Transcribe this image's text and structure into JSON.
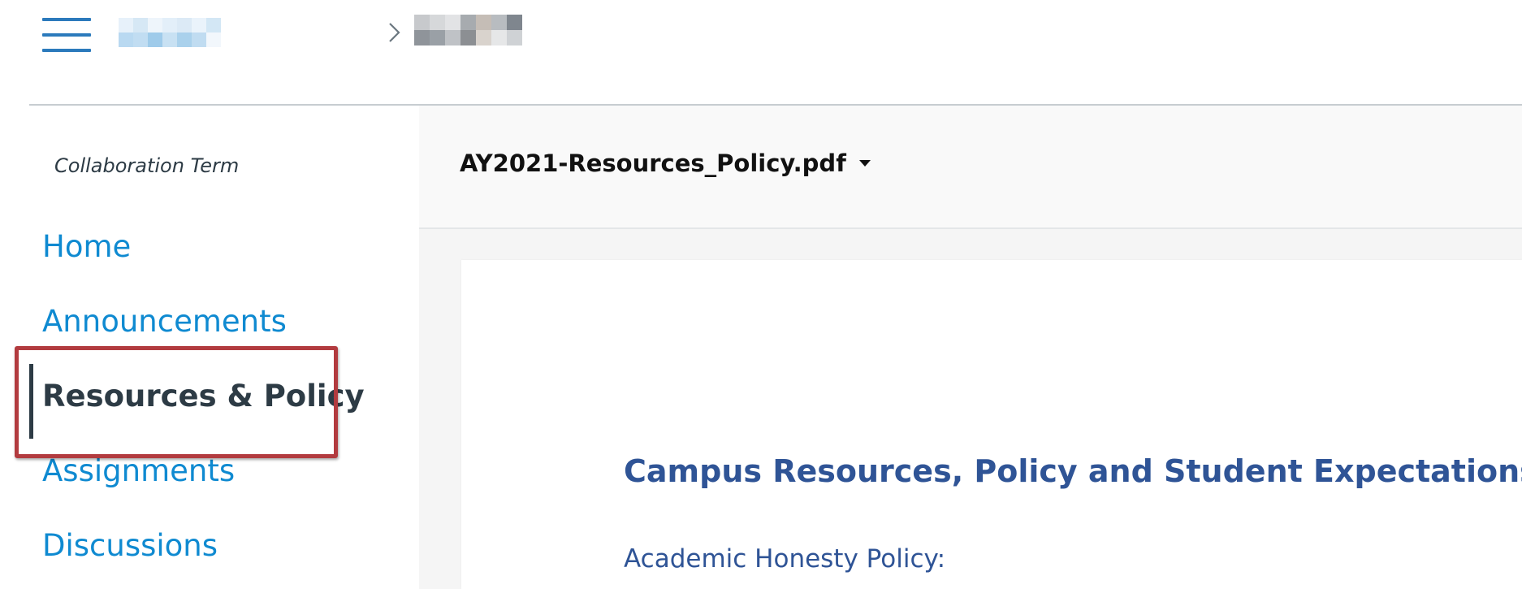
{
  "header": {
    "breadcrumb_separator": ">",
    "breadcrumb_course_colors": [
      "#e7f1fa",
      "#b9d9f1",
      "#d6e8f5",
      "#c1ddf2",
      "#eef5fb",
      "#9fcbea",
      "#e3eff9",
      "#c8e1f3",
      "#dceaf6",
      "#aad1ec",
      "#eaf3fb",
      "#c0dcf1",
      "#d3e7f5",
      "#f2f7fc"
    ],
    "breadcrumb_page_colors": [
      "#c7c9cc",
      "#8f949a",
      "#d6d8da",
      "#9aa0a6",
      "#e2e3e5",
      "#bfc2c6",
      "#a7abaf",
      "#8c8f93",
      "#c5bdb6",
      "#d9d3cd",
      "#b8bcc0",
      "#e6e7e8",
      "#7f868e",
      "#cfd2d5"
    ]
  },
  "course_nav": {
    "term_label": "Collaboration Term",
    "items": [
      {
        "label": "Home",
        "active": false
      },
      {
        "label": "Announcements",
        "active": false
      },
      {
        "label": "Resources & Policy",
        "active": true
      },
      {
        "label": "Assignments",
        "active": false
      },
      {
        "label": "Discussions",
        "active": false
      }
    ]
  },
  "viewer": {
    "file_name": "AY2021-Resources_Policy.pdf",
    "document": {
      "title": "Campus Resources, Policy and Student Expectations",
      "first_heading": "Academic Honesty Policy:"
    }
  },
  "colors": {
    "link_blue": "#0f8ad1",
    "active_text": "#2d3b45",
    "highlight_border": "#b23b3f",
    "doc_heading_blue": "#2f5496",
    "hamburger_blue": "#2b7abc"
  }
}
